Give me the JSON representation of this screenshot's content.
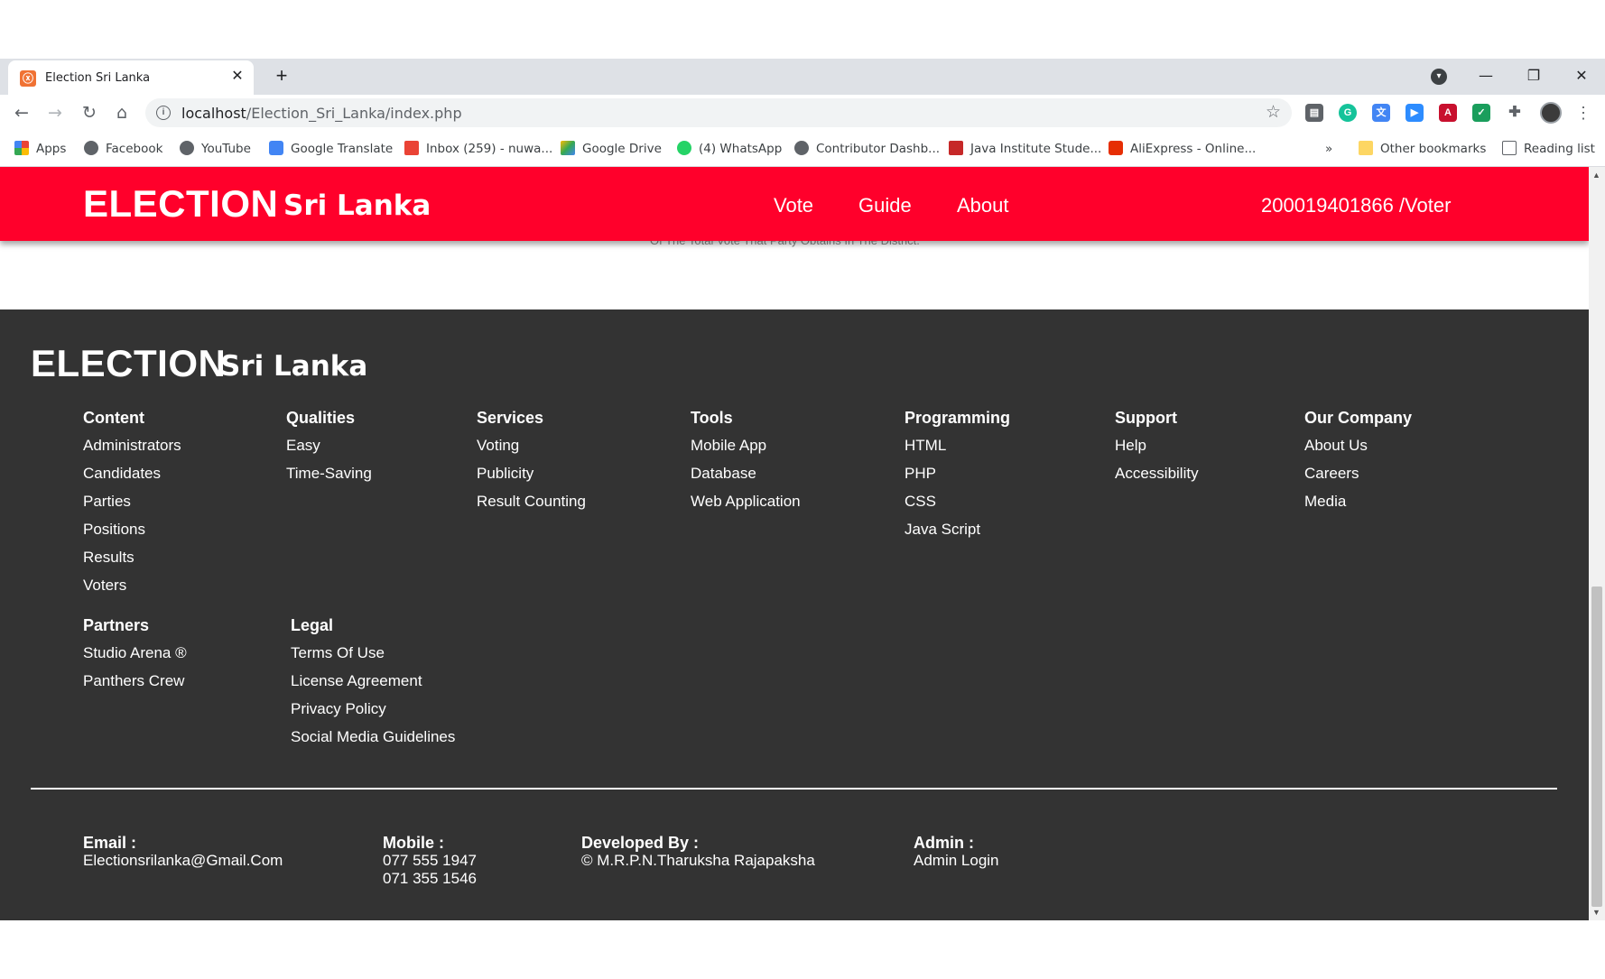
{
  "browser": {
    "tab_title": "Election Sri Lanka",
    "url_host": "localhost",
    "url_path": "/Election_Sri_Lanka/index.php",
    "bookmarks": [
      "Apps",
      "Facebook",
      "YouTube",
      "Google Translate",
      "Inbox (259) - nuwa...",
      "Google Drive",
      "(4) WhatsApp",
      "Contributor Dashb...",
      "Java Institute Stude...",
      "AliExpress - Online..."
    ],
    "overflow": "»",
    "other_bookmarks": "Other bookmarks",
    "reading_list": "Reading list"
  },
  "header": {
    "logo_main": "ELECTION",
    "logo_sub": "Sri Lanka",
    "nav": [
      "Vote",
      "Guide",
      "About"
    ],
    "voter_id": "200019401866 /Voter",
    "overlapped_text": "Of The Total Vote That Party Obtains In The District."
  },
  "footer": {
    "logo_main": "ELECTION",
    "logo_sub": "Sri Lanka",
    "columns": [
      {
        "title": "Content",
        "links": [
          "Administrators",
          "Candidates",
          "Parties",
          "Positions",
          "Results",
          "Voters"
        ]
      },
      {
        "title": "Qualities",
        "links": [
          "Easy",
          "Time-Saving"
        ]
      },
      {
        "title": "Services",
        "links": [
          "Voting",
          "Publicity",
          "Result Counting"
        ]
      },
      {
        "title": "Tools",
        "links": [
          "Mobile App",
          "Database",
          "Web Application"
        ]
      },
      {
        "title": "Programming",
        "links": [
          "HTML",
          "PHP",
          "CSS",
          "Java Script"
        ]
      },
      {
        "title": "Support",
        "links": [
          "Help",
          "Accessibility"
        ]
      },
      {
        "title": "Our Company",
        "links": [
          "About Us",
          "Careers",
          "Media"
        ]
      },
      {
        "title": "Partners",
        "links": [
          "Studio Arena ®",
          "Panthers Crew"
        ]
      },
      {
        "title": "Legal",
        "links": [
          "Terms Of Use",
          "License Agreement",
          "Privacy Policy",
          "Social Media Guidelines"
        ]
      }
    ],
    "contact": {
      "email_label": "Email :",
      "email": "Electionsrilanka@Gmail.Com",
      "mobile_label": "Mobile :",
      "mobile_1": "077 555 1947",
      "mobile_2": "071 355 1546",
      "dev_label": "Developed By :",
      "dev": "© M.R.P.N.Tharuksha Rajapaksha",
      "admin_label": "Admin :",
      "admin": "Admin Login"
    }
  },
  "colors": {
    "header_red": "#ff002b",
    "footer_bg": "#333333"
  }
}
